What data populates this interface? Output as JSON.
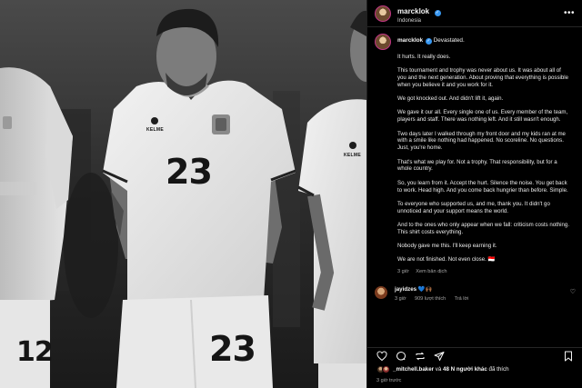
{
  "post": {
    "username": "marcklok",
    "location": "Indonesia",
    "caption_first_line": "Devastated.",
    "caption_paragraphs": [
      "It hurts. It really does.",
      "This tournament and trophy was never about us. It was about all of you and the next generation. About proving that everything is possible when you believe it and you work for it.",
      "We got knocked out. And didn't lift it, again.",
      "We gave it our all. Every single one of us. Every member of the team, players and staff. There was nothing left. And it still wasn't enough.",
      "Two days later I walked through my front door and my kids ran at me with a smile like nothing had happened. No scoreline. No questions. Just, you're home.",
      "That's what we play for. Not a trophy. That responsibility, but for a whole country.",
      "So, you learn from it. Accept the hurt. Silence the noise. You get back to work. Head high. And you come back hungrier than before. Simple.",
      "To everyone who supported us, and me, thank you. It didn't go unnoticed and your support means the world.",
      "And to the ones who only appear when we fall: criticism costs nothing. This shirt costs everything.",
      "Nobody gave me this. I'll keep earning it.",
      "We are not finished. Not even close. 🇮🇩"
    ],
    "caption_time": "3 giờ",
    "see_translation": "Xem bản dịch",
    "more_icon": "ellipsis-icon"
  },
  "comment": {
    "username": "jayidzes",
    "text": "💙🙌🏾",
    "time": "3 giờ",
    "likes": "909 lượt thích",
    "reply": "Trả lời"
  },
  "likes_line": {
    "username": "_mitchell.baker",
    "middle": " và ",
    "count": "48 N người khác",
    "suffix": " đã thích"
  },
  "timestamp": "3 giờ trước",
  "jerseys": {
    "center_number": "23",
    "center_shorts_number": "23",
    "left_number": "12",
    "brand": "KELME"
  },
  "colors": {
    "verified": "#3897f0",
    "background": "#000000",
    "secondary_text": "#a8a8a8"
  }
}
